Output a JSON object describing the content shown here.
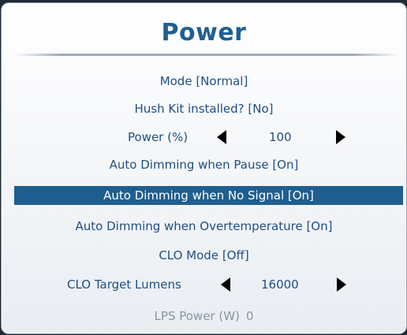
{
  "title": "Power",
  "rows": {
    "mode": "Mode [Normal]",
    "hush_kit": "Hush Kit installed? [No]",
    "power": {
      "label": "Power (%)",
      "value": "100"
    },
    "dim_pause": "Auto Dimming when Pause [On]",
    "dim_no_signal": "Auto Dimming when No Signal [On]",
    "dim_overtemp": "Auto Dimming when Overtemperature [On]",
    "clo_mode": "CLO Mode [Off]",
    "clo_target": {
      "label": "CLO Target Lumens",
      "value": "16000"
    },
    "lps_power": {
      "label": "LPS Power (W)",
      "value": "0"
    }
  },
  "colors": {
    "title": "#1f5f92",
    "text": "#1f4f84",
    "selected_background": "#1f5f8f",
    "selected_text": "#ffffff",
    "disabled_text": "#8a95a3"
  },
  "icons": {
    "decrease": "left-arrow-icon",
    "increase": "right-arrow-icon"
  }
}
